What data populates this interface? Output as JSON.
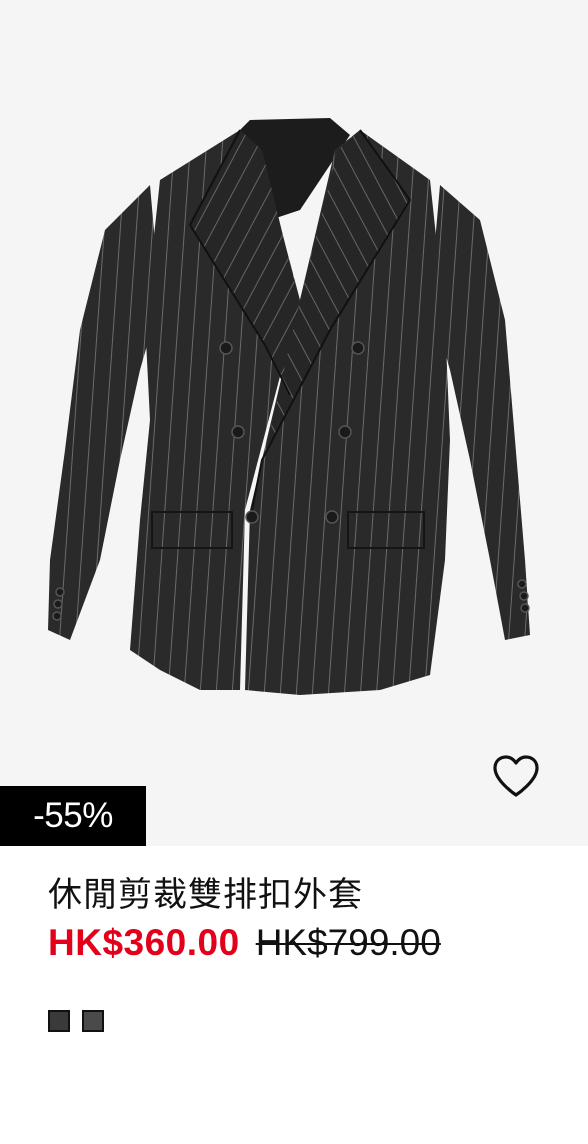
{
  "product": {
    "title": "休閒剪裁雙排扣外套",
    "sale_price": "HK$360.00",
    "original_price": "HK$799.00",
    "discount_badge": "-55%",
    "image_icon": "double-breasted-pinstripe-blazer",
    "favorite_icon": "heart-outline-icon"
  },
  "swatches": [
    {
      "color": "#3a3a3a"
    },
    {
      "color": "#4a4a4a"
    }
  ],
  "colors": {
    "sale_price": "#e3001b",
    "badge_bg": "#000000",
    "image_bg": "#f5f5f5"
  }
}
